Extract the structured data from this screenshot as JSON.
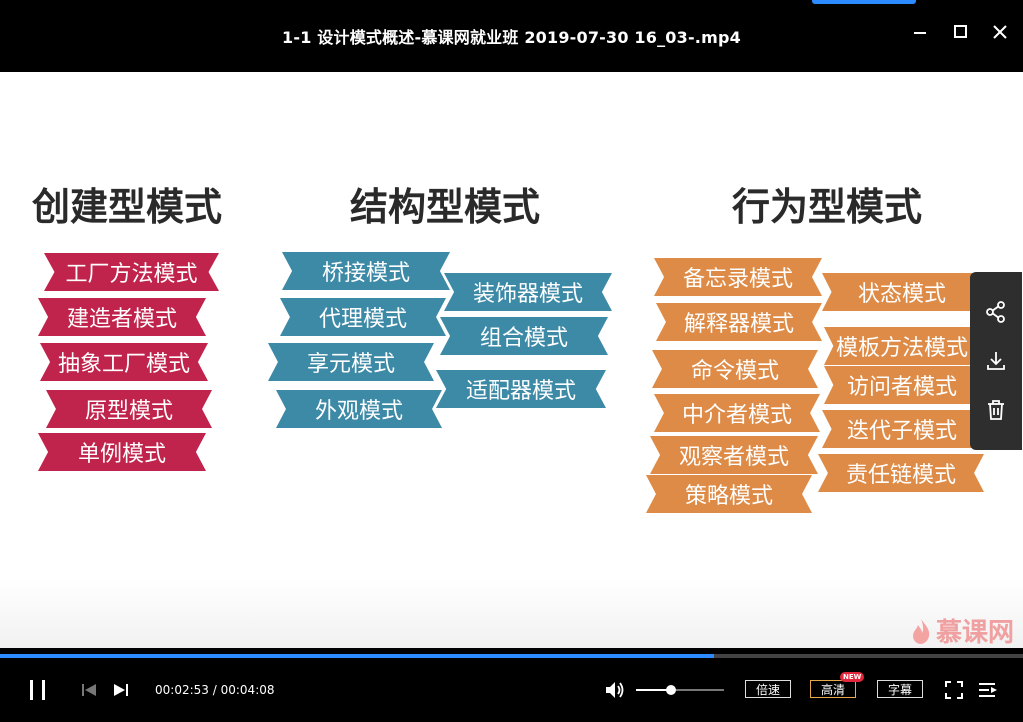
{
  "window": {
    "title": "1-1 设计模式概述-慕课网就业班 2019-07-30 16_03-.mp4",
    "accent_color": "#2b8bff"
  },
  "slide": {
    "headings": [
      "创建型模式",
      "结构型模式",
      "行为型模式"
    ],
    "creational": [
      "工厂方法模式",
      "建造者模式",
      "抽象工厂模式",
      "原型模式",
      "单例模式"
    ],
    "structural": [
      "桥接模式",
      "装饰器模式",
      "代理模式",
      "组合模式",
      "享元模式",
      "适配器模式",
      "外观模式"
    ],
    "behavioral": [
      "备忘录模式",
      "状态模式",
      "解释器模式",
      "模板方法模式",
      "命令模式",
      "访问者模式",
      "中介者模式",
      "迭代子模式",
      "观察者模式",
      "责任链模式",
      "策略模式"
    ],
    "watermark": "慕课网",
    "colors": {
      "creational": "#c0234b",
      "structural": "#3d8aa7",
      "behavioral": "#dd8b46"
    }
  },
  "side_panel": {
    "icons": [
      "share-icon",
      "download-icon",
      "trash-icon"
    ]
  },
  "player": {
    "current_time": "00:02:53",
    "separator": "/",
    "total_time": "00:04:08",
    "progress": 0.698,
    "volume": 0.4,
    "speed_label": "倍速",
    "quality_label": "高清",
    "quality_badge": "NEW",
    "subtitle_label": "字幕"
  }
}
